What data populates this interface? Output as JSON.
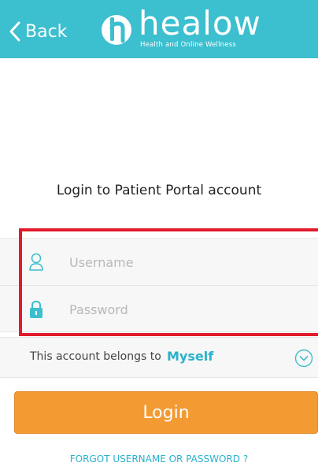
{
  "header": {
    "back_label": "Back",
    "logo_word": "healow",
    "logo_tagline": "Health and Online Wellness"
  },
  "page_title": "Login to Patient Portal account",
  "form": {
    "username": {
      "value": "",
      "placeholder": "Username",
      "icon": "user-icon"
    },
    "password": {
      "value": "",
      "placeholder": "Password",
      "icon": "lock-icon"
    }
  },
  "belongs": {
    "label": "This account belongs to",
    "value": "Myself",
    "icon": "chevron-down-circle-icon"
  },
  "login_label": "Login",
  "forgot_label": "FORGOT USERNAME OR PASSWORD ?",
  "colors": {
    "header_bg": "#3cbfcf",
    "accent": "#2ab1cc",
    "login_button": "#f39a32",
    "highlight": "#e21b2b"
  }
}
